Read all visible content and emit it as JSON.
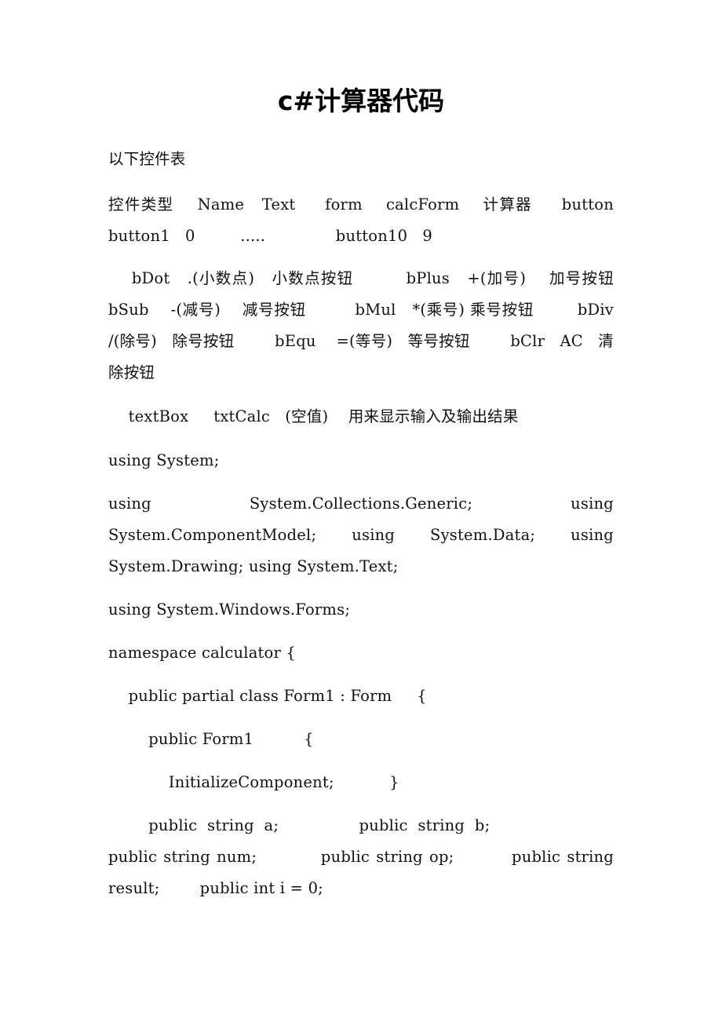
{
  "document": {
    "title": "c#计算器代码",
    "intro": "以下控件表",
    "paragraphs": [
      {
        "id": "control-table-header",
        "text": "控件类型    Name   Text     form    calcForm    计算器     button button1   0         .....              button10   9"
      },
      {
        "id": "control-table-buttons",
        "text": "    bDot   .(小数点)   小数点按钮         bPlus   +(加号)    加号按钮         bSub    -(减号)    减号按钮         bMul   *(乘号) 乘号按钮        bDiv   /(除号)   除号按钮        bEqu    =(等号)   等号按钮        bClr   AC   清除按钮"
      },
      {
        "id": "control-table-textbox",
        "text": "    textBox     txtCalc   (空值)    用来显示输入及输出结果"
      },
      {
        "id": "using-system",
        "text": "using System;"
      },
      {
        "id": "using-block",
        "text": "using  System.Collections.Generic;  using  System.ComponentModel; using System.Data; using System.Drawing; using System.Text;"
      },
      {
        "id": "using-winforms",
        "text": "using System.Windows.Forms;"
      },
      {
        "id": "namespace-decl",
        "text": "namespace calculator {"
      },
      {
        "id": "class-decl",
        "text": "    public partial class Form1 : Form     {"
      },
      {
        "id": "ctor-decl",
        "text": "        public Form1          {"
      },
      {
        "id": "initialize-component",
        "text": "            InitializeComponent;           }"
      },
      {
        "id": "fields-ab",
        "text": "        public  string  a;                public  string  b;"
      },
      {
        "id": "fields-rest",
        "text": "public string num;          public string op;         public string result;        public int i = 0;"
      }
    ]
  }
}
